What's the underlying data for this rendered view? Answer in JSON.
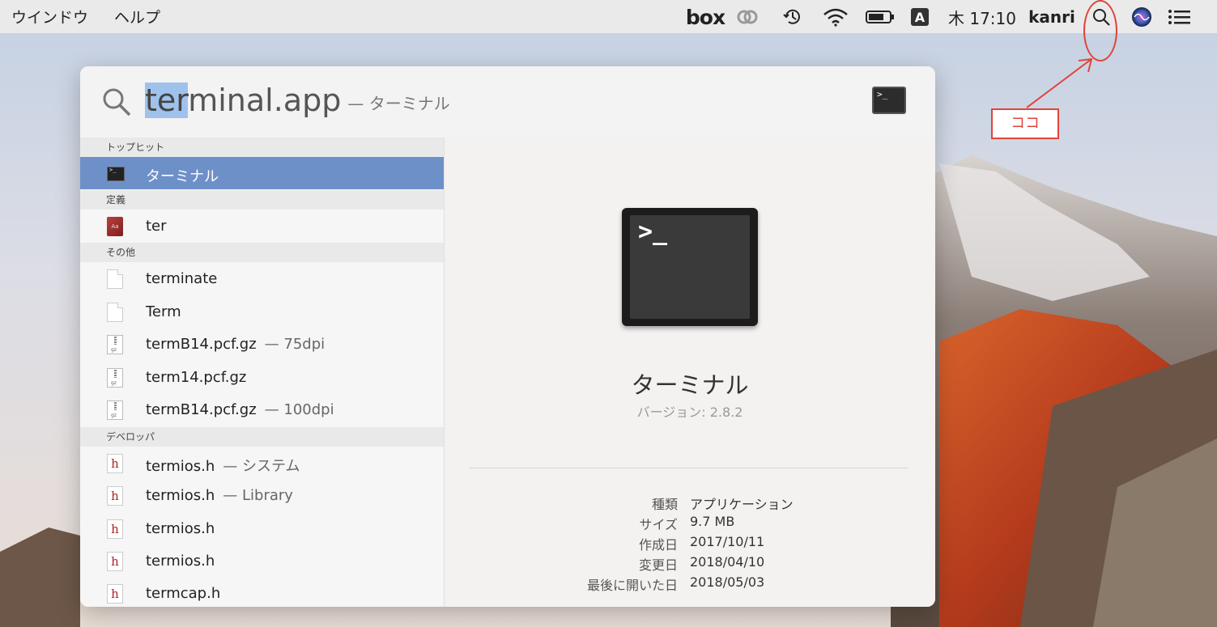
{
  "menubar": {
    "left_items": [
      "ウインドウ",
      "ヘルプ"
    ],
    "box_label": "box",
    "input_source": "A",
    "clock": "木 17:10",
    "user": "kanri"
  },
  "spotlight": {
    "query_highlight": "ter",
    "query_rest": "minal.app",
    "query_suffix": "— ターミナル",
    "sections": {
      "top_hit": "トップヒット",
      "definition": "定義",
      "other": "その他",
      "developer": "デベロッパ"
    },
    "results": [
      {
        "label": "ターミナル",
        "sub": "",
        "icon": "terminal-icon",
        "selected": true
      },
      {
        "label": "ter",
        "sub": "",
        "icon": "dictionary-icon"
      },
      {
        "label": "terminate",
        "sub": "",
        "icon": "document-icon"
      },
      {
        "label": "Term",
        "sub": "",
        "icon": "document-icon"
      },
      {
        "label": "termB14.pcf.gz",
        "sub": "— 75dpi",
        "icon": "gz-archive-icon"
      },
      {
        "label": "term14.pcf.gz",
        "sub": "",
        "icon": "gz-archive-icon"
      },
      {
        "label": "termB14.pcf.gz",
        "sub": "— 100dpi",
        "icon": "gz-archive-icon"
      },
      {
        "label": "termios.h",
        "sub": "— システム",
        "icon": "header-file-icon"
      },
      {
        "label": "termios.h",
        "sub": "— Library",
        "icon": "header-file-icon"
      },
      {
        "label": "termios.h",
        "sub": "",
        "icon": "header-file-icon"
      },
      {
        "label": "termios.h",
        "sub": "",
        "icon": "header-file-icon"
      },
      {
        "label": "termcap.h",
        "sub": "",
        "icon": "header-file-icon"
      }
    ],
    "preview": {
      "name": "ターミナル",
      "version": "バージョン: 2.8.2",
      "meta": [
        {
          "key": "種類",
          "value": "アプリケーション"
        },
        {
          "key": "サイズ",
          "value": "9.7 MB"
        },
        {
          "key": "作成日",
          "value": "2017/10/11"
        },
        {
          "key": "変更日",
          "value": "2018/04/10"
        },
        {
          "key": "最後に開いた日",
          "value": "2018/05/03"
        }
      ]
    },
    "gz_text": "gz",
    "dict_text": "Aa",
    "h_text": "h",
    "prompt_small": ">_",
    "prompt_big": ">_"
  },
  "annotation": {
    "label": "ココ",
    "color": "#e0443a"
  }
}
